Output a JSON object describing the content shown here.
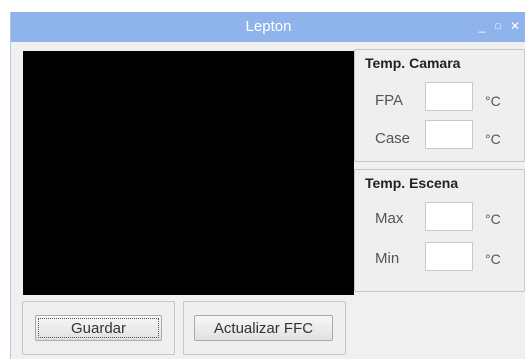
{
  "window": {
    "title": "Lepton",
    "minimize_glyph": "_",
    "maximize_glyph": "□",
    "close_glyph": "✕"
  },
  "camera_group": {
    "title": "Temp. Camara",
    "rows": [
      {
        "label": "FPA",
        "value": "",
        "unit": "°C"
      },
      {
        "label": "Case",
        "value": "",
        "unit": "°C"
      }
    ]
  },
  "scene_group": {
    "title": "Temp. Escena",
    "rows": [
      {
        "label": "Max",
        "value": "",
        "unit": "°C"
      },
      {
        "label": "Min",
        "value": "",
        "unit": "°C"
      }
    ]
  },
  "buttons": {
    "save_label": "Guardar",
    "ffc_label": "Actualizar FFC"
  },
  "colors": {
    "titlebar": "#8fb4ec",
    "window_bg": "#f0f0f0",
    "video_bg": "#000000"
  }
}
